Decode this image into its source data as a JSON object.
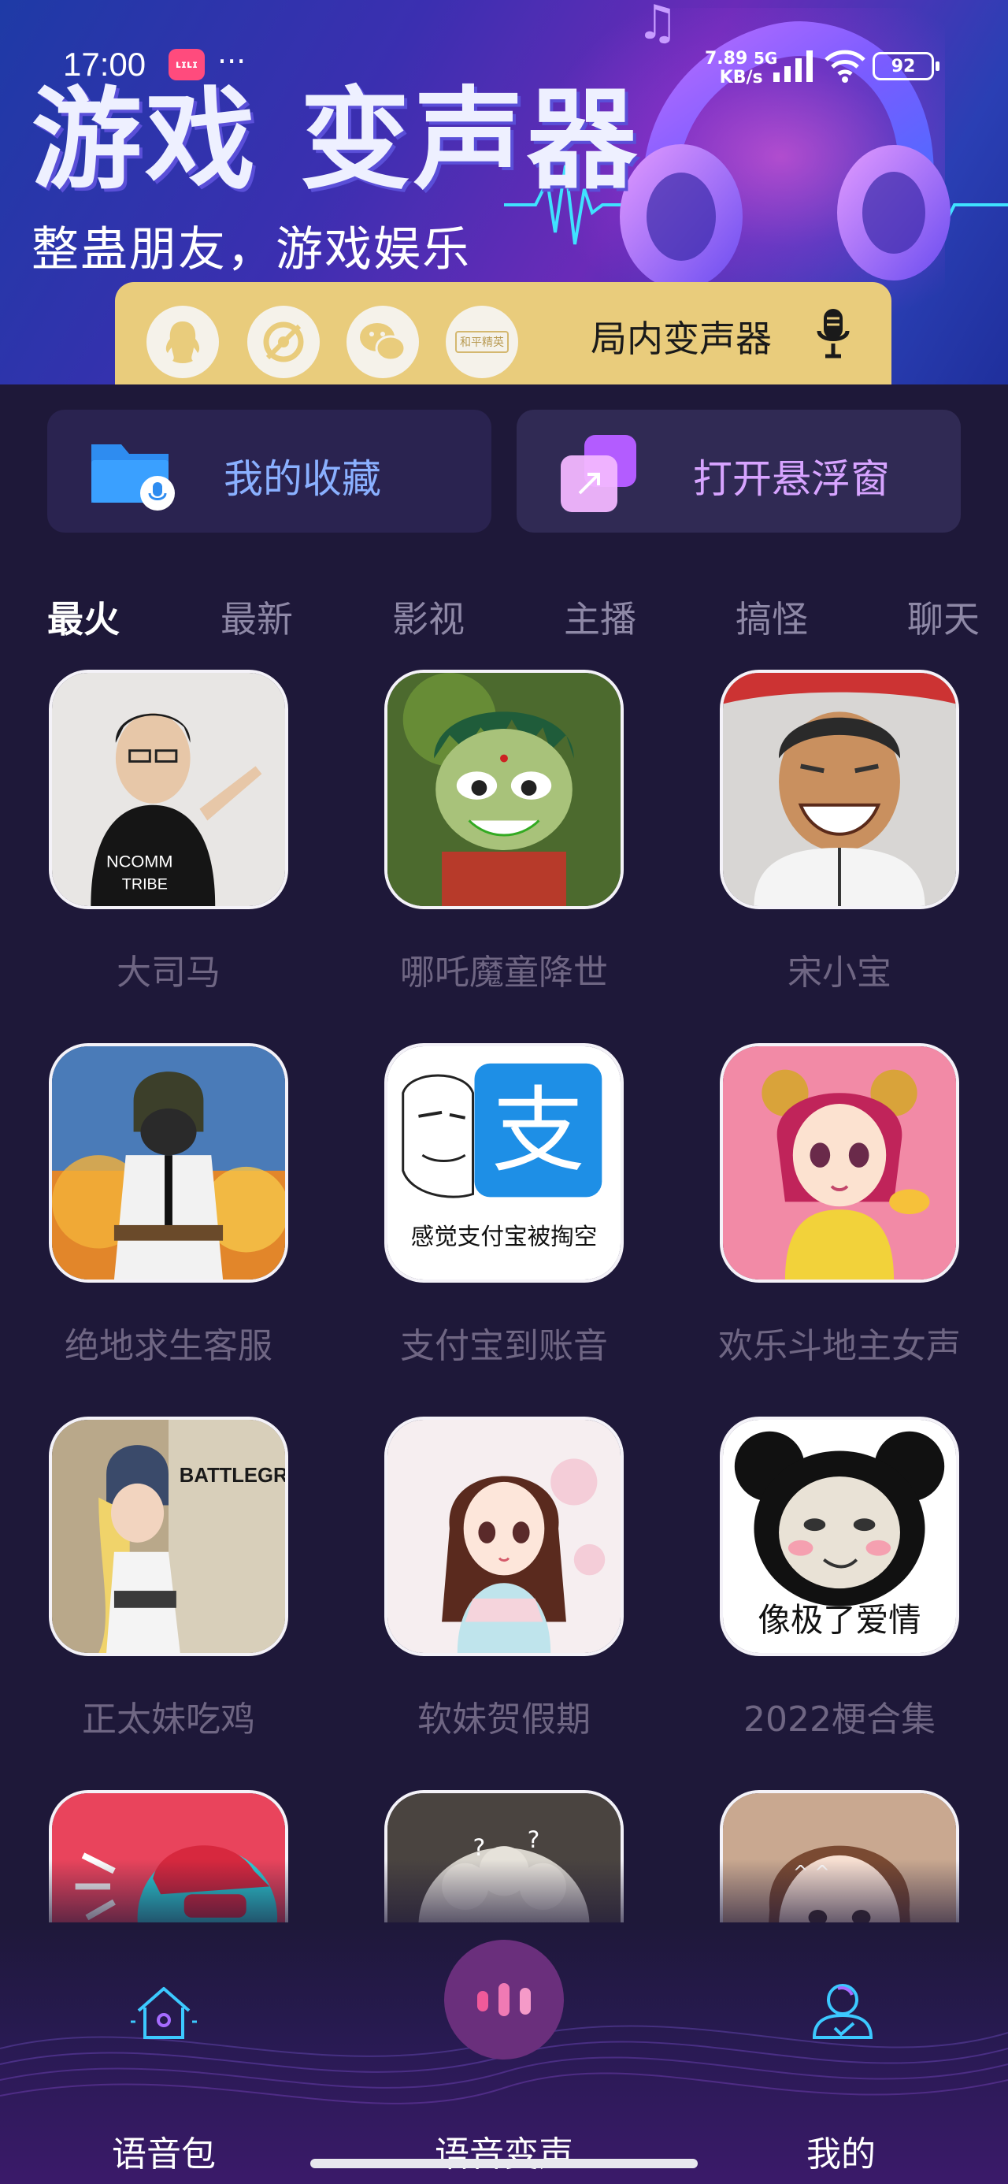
{
  "status_bar": {
    "time": "17:00",
    "app_badge": "ʟɪʟɪ",
    "more": "···",
    "speed_value": "7.89",
    "speed_unit": "KB/s",
    "network": "5G",
    "battery": "92"
  },
  "banner": {
    "title": "游戏  变声器",
    "subtitle": "整蛊朋友，游戏娱乐",
    "share_bar": {
      "label": "局内变声器",
      "icons": [
        "qq-icon",
        "qq-zone-icon",
        "wechat-icon",
        "game-peace-elite-icon"
      ],
      "game_badge_text": "和平精英"
    }
  },
  "actions": {
    "favorites": "我的收藏",
    "float_window": "打开悬浮窗"
  },
  "tabs": [
    "最火",
    "最新",
    "影视",
    "主播",
    "搞怪",
    "聊天"
  ],
  "active_tab": "最火",
  "grid": [
    {
      "label": "大司马",
      "thumb": "man-in-black-shirt"
    },
    {
      "label": "哪吒魔童降世",
      "thumb": "nezha-cartoon"
    },
    {
      "label": "宋小宝",
      "thumb": "laughing-man"
    },
    {
      "label": "绝地求生客服",
      "thumb": "pubg-soldier"
    },
    {
      "label": "支付宝到账音",
      "thumb": "alipay-meme",
      "thumb_text": "感觉支付宝被掏空",
      "thumb_logo": "支"
    },
    {
      "label": "欢乐斗地主女声",
      "thumb": "cartoon-girl-pink"
    },
    {
      "label": "正太妹吃鸡",
      "thumb": "pubg-girl",
      "thumb_text": "BATTLEGROUNDS"
    },
    {
      "label": "软妹贺假期",
      "thumb": "anime-girl"
    },
    {
      "label": "2022梗合集",
      "thumb": "panda-meme",
      "thumb_text": "像极了爱情"
    },
    {
      "label": "",
      "thumb": "tiktok-cap"
    },
    {
      "label": "",
      "thumb": "sheep"
    },
    {
      "label": "",
      "thumb": "girl-face"
    }
  ],
  "bottom_nav": {
    "items": [
      {
        "label": "语音包",
        "icon": "home-icon"
      },
      {
        "label": "语音变声",
        "icon": "voice-wave-icon"
      },
      {
        "label": "我的",
        "icon": "profile-icon"
      }
    ]
  },
  "colors": {
    "background": "#1e1839",
    "share_bar": "#e9cc7c",
    "favorites_text": "#8ab0ff",
    "float_text": "#d7a4ff",
    "tab_inactive": "#8e88a6",
    "item_label": "#6f6683"
  }
}
